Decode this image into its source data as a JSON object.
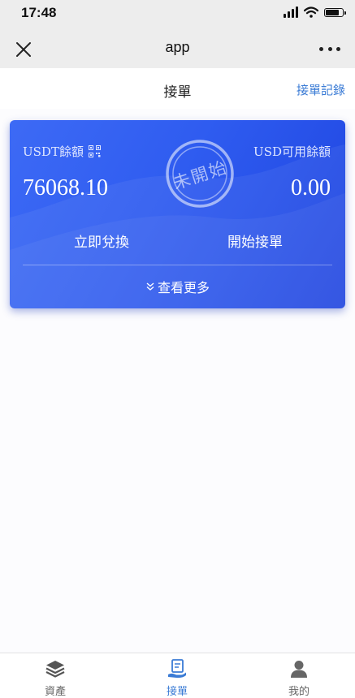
{
  "status_bar": {
    "time": "17:48",
    "battery_level": 0.8
  },
  "app_bar": {
    "title": "app"
  },
  "page": {
    "title": "接單",
    "records_link": "接單記錄"
  },
  "card": {
    "usdt_label": "USDT餘額",
    "usdt_value": "76068.10",
    "usd_label": "USD可用餘額",
    "usd_value": "0.00",
    "stamp_text": "未開始",
    "exchange_button": "立即兌換",
    "start_button": "開始接單",
    "view_more": "查看更多",
    "gradient_colors": [
      "#3d6af5",
      "#1e44e0"
    ]
  },
  "bottom_nav": {
    "items": [
      {
        "label": "資產",
        "icon": "layers-icon",
        "active": false
      },
      {
        "label": "接單",
        "icon": "order-hand-icon",
        "active": true
      },
      {
        "label": "我的",
        "icon": "user-icon",
        "active": false
      }
    ],
    "active_color": "#3a7bd5",
    "inactive_color": "#666666"
  }
}
